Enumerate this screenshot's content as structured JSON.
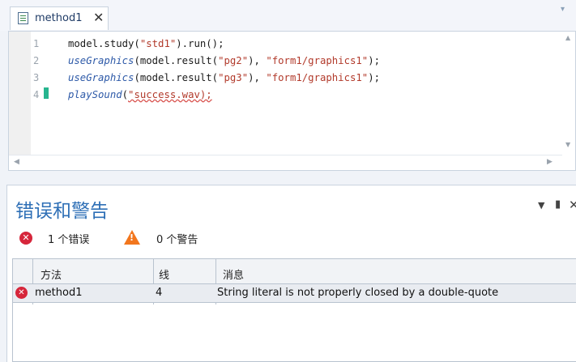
{
  "tab": {
    "label": "method1",
    "close": "✕",
    "overflow": "▾"
  },
  "editor": {
    "line_numbers": [
      "1",
      "2",
      "3",
      "4"
    ],
    "lines": [
      [
        {
          "t": "model.study(",
          "c": ""
        },
        {
          "t": "\"std1\"",
          "c": "str"
        },
        {
          "t": ").run();",
          "c": ""
        }
      ],
      [
        {
          "t": "useGraphics",
          "c": "kw"
        },
        {
          "t": "(model.result(",
          "c": ""
        },
        {
          "t": "\"pg2\"",
          "c": "str"
        },
        {
          "t": "), ",
          "c": ""
        },
        {
          "t": "\"form1/graphics1\"",
          "c": "str"
        },
        {
          "t": ");",
          "c": ""
        }
      ],
      [
        {
          "t": "useGraphics",
          "c": "kw"
        },
        {
          "t": "(model.result(",
          "c": ""
        },
        {
          "t": "\"pg3\"",
          "c": "str"
        },
        {
          "t": "), ",
          "c": ""
        },
        {
          "t": "\"form1/graphics1\"",
          "c": "str"
        },
        {
          "t": ");",
          "c": ""
        }
      ],
      [
        {
          "t": "playSound",
          "c": "kw"
        },
        {
          "t": "(",
          "c": ""
        },
        {
          "t": "\"success.wav);",
          "c": "str squig"
        }
      ]
    ],
    "scroll_up": "▲",
    "scroll_down": "▼",
    "scroll_left": "◀",
    "scroll_right": "▶"
  },
  "panel": {
    "title": "错误和警告",
    "menu": "▼",
    "pin": "▮",
    "close": "✕",
    "error_count": "1 个错误",
    "warning_count": "0 个警告",
    "error_icon": "✕",
    "warning_icon": "!",
    "columns": [
      "方法",
      "线",
      "消息"
    ],
    "rows": [
      {
        "method": "method1",
        "line": "4",
        "message": "String literal is not properly closed by a double-quote"
      }
    ]
  },
  "colors": {
    "accent": "#2e6fb6",
    "error": "#d6263b",
    "warning": "#f2761d",
    "marker": "#27b58f"
  }
}
